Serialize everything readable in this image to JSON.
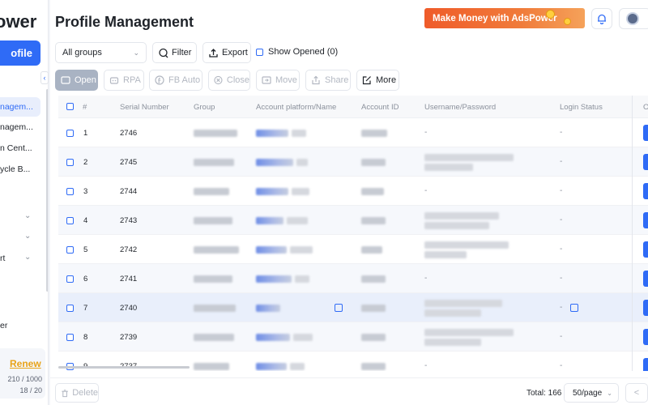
{
  "sidebar": {
    "brand": "ower",
    "new_profile_label": "ofile",
    "items": [
      {
        "label": "nagem..."
      },
      {
        "label": "nagem..."
      },
      {
        "label": "n Cent..."
      },
      {
        "label": "ycle B..."
      }
    ],
    "misc_labels": [
      "rt",
      "er"
    ],
    "renew_label": "Renew",
    "quota_profiles": "210 / 1000",
    "quota_members": "18 / 20"
  },
  "header": {
    "title": "Profile Management",
    "promo_text": "Make Money with AdsPower"
  },
  "toolbar": {
    "group_select": "All groups",
    "filter_label": "Filter",
    "export_label": "Export",
    "show_opened_label": "Show Opened (0)"
  },
  "actions": {
    "open": "Open",
    "rpa": "RPA",
    "fb_auto": "FB Auto",
    "close": "Close",
    "move": "Move",
    "share": "Share",
    "more": "More"
  },
  "table": {
    "columns": [
      "#",
      "Serial Number",
      "Group",
      "Account platform/Name",
      "Account ID",
      "Username/Password",
      "Login Status"
    ],
    "last_column_partial": "O",
    "rows": [
      {
        "index": "1",
        "serial": "2746",
        "username": "-",
        "login": "-"
      },
      {
        "index": "2",
        "serial": "2745",
        "username": "",
        "login": "-"
      },
      {
        "index": "3",
        "serial": "2744",
        "username": "-",
        "login": "-"
      },
      {
        "index": "4",
        "serial": "2743",
        "username": "",
        "login": "-"
      },
      {
        "index": "5",
        "serial": "2742",
        "username": "",
        "login": "-"
      },
      {
        "index": "6",
        "serial": "2741",
        "username": "-",
        "login": "-"
      },
      {
        "index": "7",
        "serial": "2740",
        "username": "",
        "login": "-"
      },
      {
        "index": "8",
        "serial": "2739",
        "username": "",
        "login": "-"
      },
      {
        "index": "9",
        "serial": "2737",
        "username": "-",
        "login": "-"
      }
    ]
  },
  "footer": {
    "delete_label": "Delete",
    "total": "Total: 166",
    "page_size": "50/page",
    "prev": "<"
  },
  "colors": {
    "accent": "#2f6bf6",
    "promo": "#ef5b2a",
    "renew": "#e8a318"
  }
}
